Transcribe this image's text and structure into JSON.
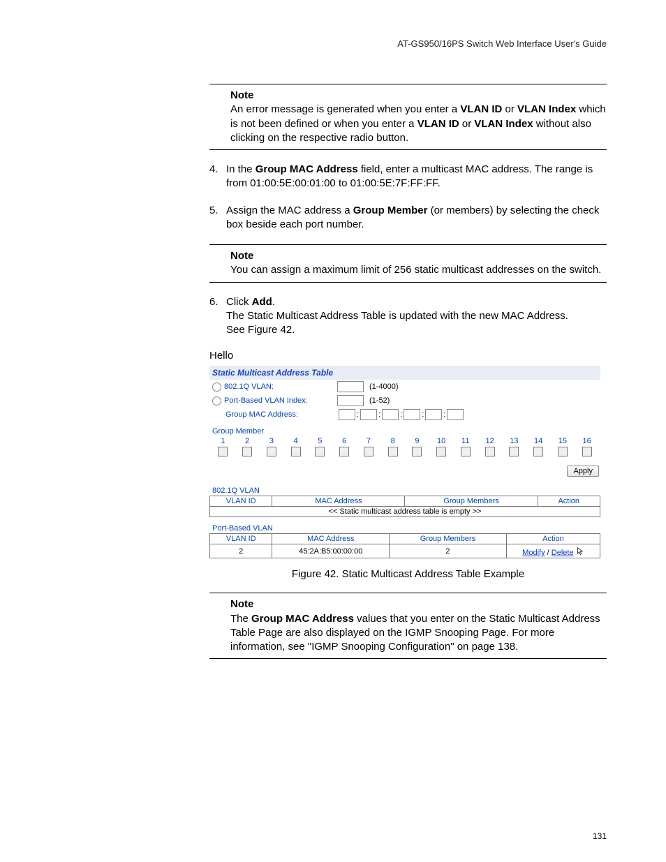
{
  "header": {
    "title": "AT-GS950/16PS Switch Web Interface User's Guide"
  },
  "notes": {
    "n1": {
      "heading": "Note",
      "body_pre": "An error message is generated when you enter a ",
      "b1": "VLAN ID",
      "mid1": " or ",
      "b2": "VLAN Index",
      "mid2": " which is not been defined or when you enter a ",
      "b3": "VLAN ID",
      "mid3": " or ",
      "b4": "VLAN Index",
      "tail": " without also clicking on the respective radio button."
    },
    "n2": {
      "heading": "Note",
      "body": "You can assign a maximum limit of 256 static multicast addresses on the switch."
    },
    "n3": {
      "heading": "Note",
      "pre": "The ",
      "b1": "Group MAC Address",
      "tail": " values that you enter on the Static Multicast Address Table Page are also displayed on the IGMP Snooping Page. For more information, see \"IGMP Snooping Configuration\" on page 138."
    }
  },
  "steps": {
    "s4": {
      "num": "4.",
      "pre": "In the ",
      "b1": "Group MAC Address",
      "mid": " field, enter a multicast MAC address. The range is from 01:00:5E:00:01:00 to 01:00:5E:7F:FF:FF."
    },
    "s5": {
      "num": "5.",
      "pre": "Assign the MAC address a ",
      "b1": "Group Member",
      "tail": " (or members) by selecting the check box beside each port number."
    },
    "s6": {
      "num": "6.",
      "pre": "Click ",
      "b1": "Add",
      "dot": ".",
      "line2": "The Static Multicast Address Table is updated with the new MAC Address.",
      "line3": "See Figure 42."
    }
  },
  "hello": "Hello",
  "figure": {
    "caption": "Figure 42. Static Multicast Address Table Example",
    "title": "Static Multicast Address Table",
    "vlan802_label": "802.1Q VLAN:",
    "vlan802_range": "(1-4000)",
    "portvlan_label": "Port-Based VLAN Index:",
    "portvlan_range": "(1-52)",
    "mac_label": "Group MAC Address:",
    "member_label": "Group Member",
    "ports": [
      "1",
      "2",
      "3",
      "4",
      "5",
      "6",
      "7",
      "8",
      "9",
      "10",
      "11",
      "12",
      "13",
      "14",
      "15",
      "16"
    ],
    "apply": "Apply",
    "section1": "802.1Q VLAN",
    "section2": "Port-Based VLAN",
    "cols": {
      "vlan": "VLAN ID",
      "mac": "MAC Address",
      "members": "Group Members",
      "action": "Action"
    },
    "empty_msg": "<< Static multicast address table is empty >>",
    "row2": {
      "vlan": "2",
      "mac": "45:2A:B5:00:00:00",
      "members": "2",
      "modify": "Modify",
      "sep": " / ",
      "delete": "Delete"
    }
  },
  "page_number": "131"
}
